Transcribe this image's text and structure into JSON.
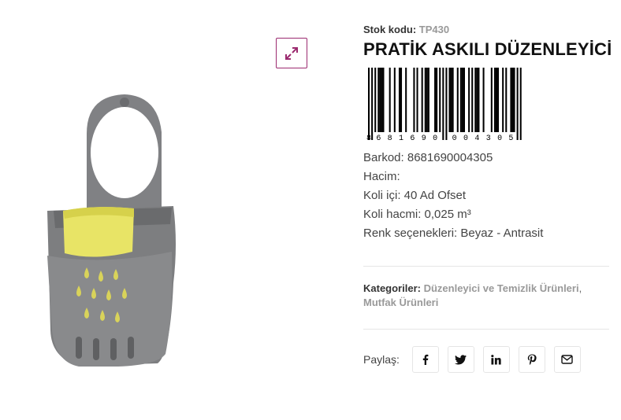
{
  "gallery": {
    "image_alt": "Pratik Askılı Düzenleyici",
    "zoom_icon": "expand-icon"
  },
  "product": {
    "sku_label": "Stok kodu:",
    "sku_value": "TP430",
    "title": "PRATİK ASKILI DÜZENLEYİCİ",
    "barcode_digits": "8681690004305",
    "specs": {
      "barkod": "Barkod: 8681690004305",
      "hacim": "Hacim:",
      "koli_ici": "Koli içi: 40 Ad Ofset",
      "koli_hacmi": "Koli hacmi: 0,025 m³",
      "renk": "Renk seçenekleri: Beyaz - Antrasit"
    },
    "categories": {
      "label": "Kategoriler:",
      "items": [
        "Düzenleyici ve Temizlik Ürünleri",
        "Mutfak Ürünleri"
      ],
      "separator": ","
    }
  },
  "share": {
    "label": "Paylaş:",
    "icons": [
      "facebook-icon",
      "twitter-icon",
      "linkedin-icon",
      "pinterest-icon",
      "email-icon"
    ]
  },
  "colors": {
    "accent": "#9b2a6f",
    "product_body": "#7d7e80",
    "sponge": "#e8e466"
  }
}
